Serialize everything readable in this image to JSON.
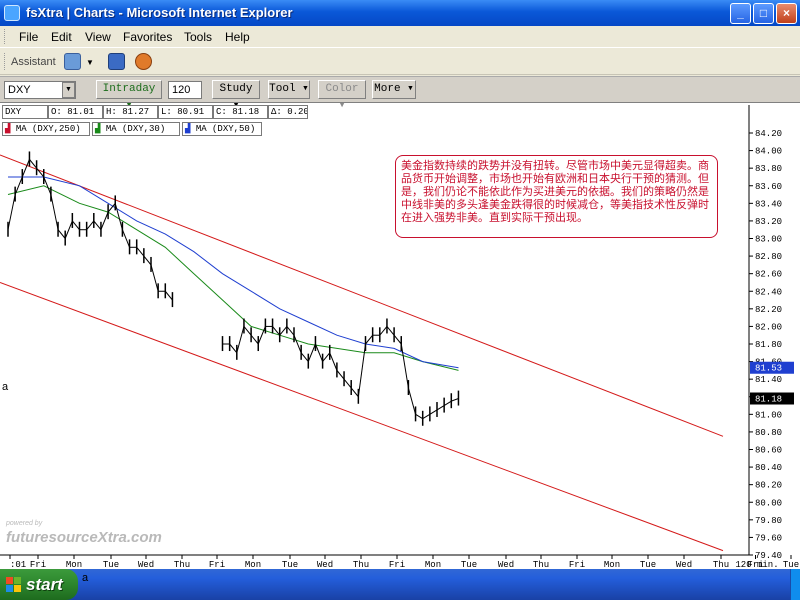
{
  "window": {
    "title": "fsXtra | Charts - Microsoft Internet Explorer",
    "controls": [
      "_",
      "□",
      "×"
    ]
  },
  "menu": [
    "File",
    "Edit",
    "View",
    "Favorites",
    "Tools",
    "Help"
  ],
  "assistant": {
    "label": "Assistant"
  },
  "toolbar": {
    "symbol": "DXY",
    "interval_button": "Intraday",
    "interval_value": "120",
    "buttons": [
      "Study",
      "Tool",
      "Color",
      "More"
    ]
  },
  "quote": {
    "symbol": "DXY",
    "open": "O: 81.01",
    "high": "H: 81.27",
    "low": "L: 80.91",
    "close": "C: 81.18",
    "change": "Δ: 0.20"
  },
  "studies": [
    {
      "label": "MA (DXY,250)",
      "color": "#c8102e"
    },
    {
      "label": "MA (DXY,30)",
      "color": "#1a8a1a"
    },
    {
      "label": "MA (DXY,50)",
      "color": "#1f3fd0"
    }
  ],
  "annotation": "美金指数持续的跌势并没有扭转。尽管市场中美元显得超卖。商品货币开始调整，市场也开始有欧洲和日本央行干预的猜测。但是，我们仍论不能依此作为买进美元的依据。我们的策略仍然是中线非美的多头逢美金跌得很的时候减仓，等美指技术性反弹时在进入强势非美。直到实际干预出现。",
  "watermark": {
    "small": "powered by",
    "brand": "futuresourceXtra.com"
  },
  "taskbar": {
    "start_label": "start",
    "after_text": "a"
  },
  "left_marker": "a",
  "chart_data": {
    "type": "candlestick",
    "symbol": "DXY",
    "ylim": [
      79.4,
      84.2
    ],
    "y_ticks": [
      "84.20",
      "84.00",
      "83.80",
      "83.60",
      "83.40",
      "83.20",
      "83.00",
      "82.80",
      "82.60",
      "82.40",
      "82.20",
      "82.00",
      "81.80",
      "81.60",
      "81.40",
      "81.20",
      "81.00",
      "80.80",
      "80.60",
      "80.40",
      "80.20",
      "80.00",
      "79.80",
      "79.60",
      "79.40"
    ],
    "x_labels": [
      ":01",
      "Fri",
      "Mon",
      "Tue",
      "Wed",
      "Thu",
      "Fri",
      "Mon",
      "Tue",
      "Wed",
      "Thu",
      "Fri",
      "Mon",
      "Tue",
      "Wed",
      "Thu",
      "Fri",
      "Mon",
      "Tue",
      "Wed",
      "Thu",
      "Fri",
      "Tue",
      "Wed",
      "Thu",
      "120 min."
    ],
    "last_price_labels": [
      {
        "value": 81.53,
        "label": "81.53",
        "color": "#1f3fd0"
      },
      {
        "value": 81.18,
        "label": "81.18",
        "color": "#000000"
      }
    ],
    "price_path": [
      [
        0,
        83.1
      ],
      [
        1,
        83.5
      ],
      [
        2,
        83.7
      ],
      [
        3,
        83.9
      ],
      [
        4,
        83.8
      ],
      [
        5,
        83.7
      ],
      [
        6,
        83.5
      ],
      [
        7,
        83.1
      ],
      [
        8,
        83.0
      ],
      [
        9,
        83.2
      ],
      [
        10,
        83.1
      ],
      [
        11,
        83.1
      ],
      [
        12,
        83.2
      ],
      [
        13,
        83.1
      ],
      [
        14,
        83.3
      ],
      [
        15,
        83.4
      ],
      [
        16,
        83.1
      ],
      [
        17,
        82.9
      ],
      [
        18,
        82.9
      ],
      [
        19,
        82.8
      ],
      [
        20,
        82.7
      ],
      [
        21,
        82.4
      ],
      [
        22,
        82.4
      ],
      [
        23,
        82.3
      ],
      [
        30,
        81.8
      ],
      [
        31,
        81.8
      ],
      [
        32,
        81.7
      ],
      [
        33,
        82.0
      ],
      [
        34,
        81.9
      ],
      [
        35,
        81.8
      ],
      [
        36,
        82.0
      ],
      [
        37,
        82.0
      ],
      [
        38,
        81.9
      ],
      [
        39,
        82.0
      ],
      [
        40,
        81.9
      ],
      [
        41,
        81.7
      ],
      [
        42,
        81.6
      ],
      [
        43,
        81.8
      ],
      [
        44,
        81.6
      ],
      [
        45,
        81.7
      ],
      [
        46,
        81.5
      ],
      [
        47,
        81.4
      ],
      [
        48,
        81.3
      ],
      [
        49,
        81.2
      ],
      [
        50,
        81.8
      ],
      [
        51,
        81.9
      ],
      [
        52,
        81.9
      ],
      [
        53,
        82.0
      ],
      [
        54,
        81.9
      ],
      [
        55,
        81.8
      ],
      [
        56,
        81.3
      ],
      [
        57,
        81.0
      ],
      [
        58,
        80.95
      ],
      [
        59,
        81.0
      ],
      [
        60,
        81.05
      ],
      [
        61,
        81.1
      ],
      [
        62,
        81.15
      ],
      [
        63,
        81.18
      ]
    ],
    "ma_250": [],
    "ma_30": [
      [
        0,
        83.5
      ],
      [
        5,
        83.6
      ],
      [
        10,
        83.4
      ],
      [
        14,
        83.3
      ],
      [
        18,
        83.1
      ],
      [
        22,
        82.9
      ],
      [
        26,
        82.6
      ],
      [
        30,
        82.3
      ],
      [
        34,
        82.0
      ],
      [
        38,
        81.9
      ],
      [
        42,
        81.8
      ],
      [
        46,
        81.75
      ],
      [
        50,
        81.7
      ],
      [
        54,
        81.7
      ],
      [
        58,
        81.6
      ],
      [
        63,
        81.5
      ]
    ],
    "ma_50": [
      [
        0,
        83.7
      ],
      [
        5,
        83.7
      ],
      [
        10,
        83.6
      ],
      [
        14,
        83.4
      ],
      [
        18,
        83.2
      ],
      [
        22,
        83.05
      ],
      [
        26,
        82.85
      ],
      [
        30,
        82.6
      ],
      [
        34,
        82.4
      ],
      [
        38,
        82.2
      ],
      [
        42,
        82.05
      ],
      [
        46,
        81.9
      ],
      [
        50,
        81.8
      ],
      [
        54,
        81.75
      ],
      [
        58,
        81.6
      ],
      [
        63,
        81.53
      ]
    ],
    "channel_upper": [
      [
        0,
        83.95
      ],
      [
        100,
        80.75
      ]
    ],
    "channel_lower": [
      [
        0,
        82.5
      ],
      [
        100,
        79.45
      ]
    ]
  }
}
